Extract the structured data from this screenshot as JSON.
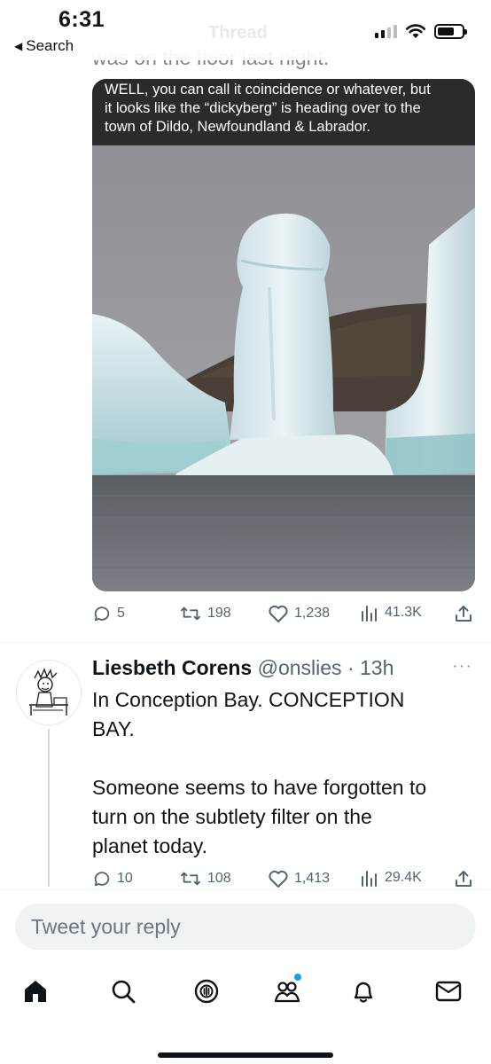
{
  "status_bar": {
    "time": "6:31",
    "back_label": "Search",
    "ghost_title": "Thread",
    "battery_level": 0.68,
    "signal_bars_filled": 2
  },
  "previous_tweet": {
    "cut_text": "was on the floor last night.",
    "media": {
      "caption_lines": [
        "WELL, you can call it coincidence or whatever, but",
        "it looks like the “dickyberg” is heading over to the",
        "town of Dildo, Newfoundland & Labrador."
      ],
      "image_subject": "iceberg"
    },
    "stats": {
      "replies": "5",
      "retweets": "198",
      "likes": "1,238",
      "views": "41.3K"
    }
  },
  "reply": {
    "name": "Liesbeth Corens",
    "handle": "@onslies",
    "time_sep": " · ",
    "time": "13h",
    "more": "···",
    "body_paragraphs": [
      [
        "In Conception Bay. CONCEPTION",
        "BAY."
      ],
      [
        "Someone seems to have forgotten to",
        "turn on the subtlety filter on the",
        "planet today."
      ]
    ],
    "stats": {
      "replies": "10",
      "retweets": "108",
      "likes": "1,413",
      "views": "29.4K"
    }
  },
  "composer": {
    "placeholder": "Tweet your reply"
  },
  "tabs": [
    "home-icon",
    "search-icon",
    "spaces-icon",
    "communities-icon",
    "notifications-icon",
    "messages-icon"
  ],
  "colors": {
    "accent": "#1d9bf0",
    "text_secondary": "#536471",
    "caption_band": "#2b2b2b"
  }
}
